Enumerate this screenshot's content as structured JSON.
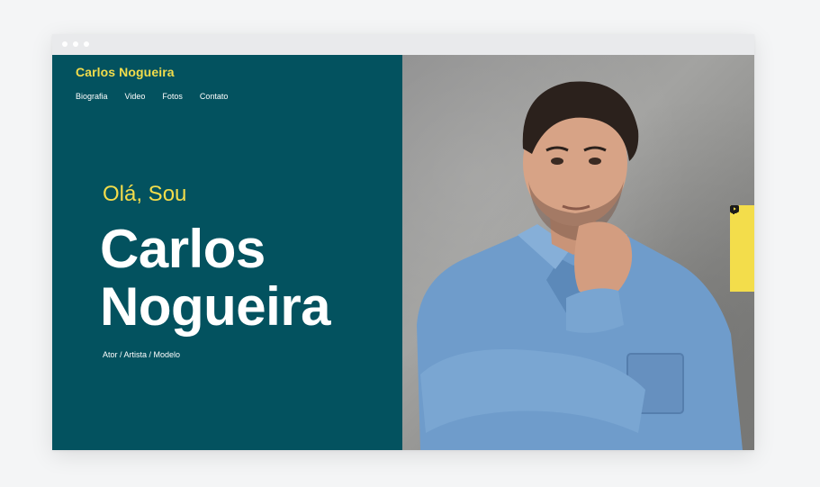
{
  "site": {
    "brand": "Carlos Nogueira",
    "nav": [
      {
        "label": "Biografia"
      },
      {
        "label": "Video"
      },
      {
        "label": "Fotos"
      },
      {
        "label": "Contato"
      }
    ],
    "hero": {
      "greeting": "Olá, Sou",
      "name_line1": "Carlos",
      "name_line2": "Nogueira",
      "roles": "Ator / Artista / Modelo"
    },
    "social": [
      {
        "icon": "facebook-icon"
      },
      {
        "icon": "twitter-icon"
      },
      {
        "icon": "instagram-icon"
      },
      {
        "icon": "youtube-icon"
      }
    ]
  },
  "colors": {
    "panel": "#03525f",
    "accent": "#f3dd4b",
    "text": "#ffffff"
  }
}
